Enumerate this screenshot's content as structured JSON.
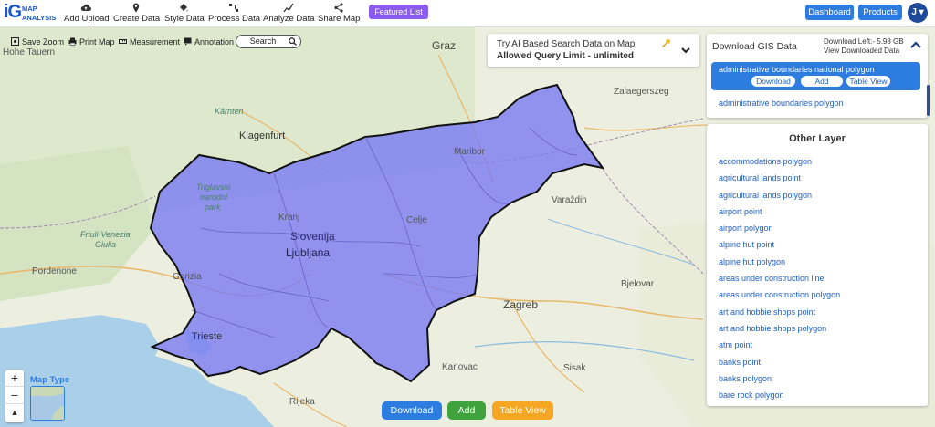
{
  "app": {
    "logo_top": "MAP",
    "logo_bottom": "ANALYSIS",
    "logo_mark": "iG"
  },
  "nav": [
    {
      "label": "Add Upload",
      "icon": "cloud-upload-icon"
    },
    {
      "label": "Create Data",
      "icon": "map-pin-icon"
    },
    {
      "label": "Style Data",
      "icon": "paint-bucket-icon"
    },
    {
      "label": "Process Data",
      "icon": "process-icon"
    },
    {
      "label": "Analyze Data",
      "icon": "analyze-icon"
    },
    {
      "label": "Share Map",
      "icon": "share-icon"
    }
  ],
  "featured_label": "Featured List",
  "dashboard_label": "Dashboard",
  "products_label": "Products",
  "user_initial": "J",
  "tools": {
    "save_zoom": "Save Zoom",
    "print_map": "Print Map",
    "measurement": "Measurement",
    "annotation": "Annotation",
    "search": "Search"
  },
  "ai_box": {
    "line1": "Try AI Based Search Data on Map",
    "line2": "Allowed Query Limit - unlimited"
  },
  "gis_panel": {
    "title": "Download GIS Data",
    "download_left": "Download Left:- 5.98 GB",
    "view_downloaded": "View Downloaded Data",
    "selected_layer": "administrative boundaries national polygon",
    "selected_buttons": [
      "Download",
      "Add",
      "Table View"
    ],
    "other_result": "administrative boundaries polygon"
  },
  "other_layer": {
    "title": "Other Layer",
    "items": [
      "accommodations polygon",
      "agricultural lands point",
      "agricultural lands polygon",
      "airport point",
      "airport polygon",
      "alpine hut point",
      "alpine hut polygon",
      "areas under construction line",
      "areas under construction polygon",
      "art and hobbie shops point",
      "art and hobbie shops polygon",
      "atm point",
      "banks point",
      "banks polygon",
      "bare rock polygon"
    ]
  },
  "map_labels": {
    "graz": "Graz",
    "zalaegerszeg": "Zalaegerszeg",
    "karnten": "Kärnten",
    "klagenfurt": "Klagenfurt",
    "maribor": "Maribor",
    "varazdin": "Varaždin",
    "triglav1": "Triglavski",
    "triglav2": "narodni",
    "triglav3": "park",
    "kranj": "Kranj",
    "slovenija": "Slovenija",
    "ljubljana": "Ljubljana",
    "celje": "Celje",
    "friuli1": "Friuli-Venezia",
    "friuli2": "Giulia",
    "pordenone": "Pordenone",
    "gorizia": "Gorizia",
    "trieste": "Trieste",
    "zagreb": "Zagreb",
    "bjelovar": "Bjelovar",
    "karlovac": "Karlovac",
    "sisak": "Sisak",
    "rijeka": "Rijeka",
    "hohe_tauern": "Hohe Tauern"
  },
  "map_controls": {
    "zoom_in": "+",
    "zoom_out": "−",
    "reset": "▲",
    "map_type": "Map Type"
  },
  "bottom_buttons": {
    "download": "Download",
    "add": "Add",
    "table_view": "Table View"
  },
  "colors": {
    "brand_blue": "#2d7de1",
    "featured_purple": "#8a5cf0",
    "highlight_polygon": "#7b7ef2",
    "add_green": "#3fa23c",
    "table_orange": "#f5a623"
  }
}
